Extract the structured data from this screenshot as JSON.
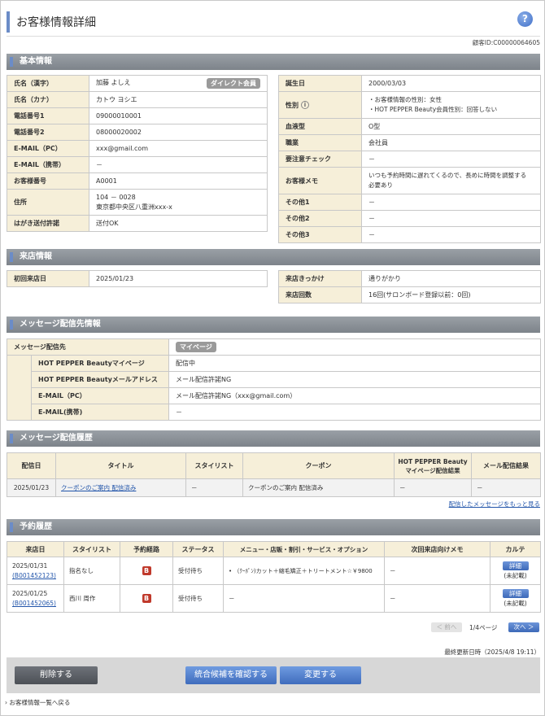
{
  "page": {
    "title": "お客様情報詳細",
    "help": "?",
    "customer_id": "顧客ID:C00000064605"
  },
  "sections": {
    "basic": "基本情報",
    "visit": "来店情報",
    "message_dest": "メッセージ配信先情報",
    "message_history": "メッセージ配信履歴",
    "reservation_history": "予約履歴"
  },
  "basic_left": {
    "rows": [
      {
        "label": "氏名（漢字）",
        "value": "加藤 よしえ",
        "badge": "ダイレクト会員"
      },
      {
        "label": "氏名（カナ）",
        "value": "カトウ ヨシエ"
      },
      {
        "label": "電話番号1",
        "value": "09000010001"
      },
      {
        "label": "電話番号2",
        "value": "08000020002"
      },
      {
        "label": "E-MAIL（PC）",
        "value": "xxx@gmail.com"
      },
      {
        "label": "E-MAIL（携帯）",
        "value": "－"
      },
      {
        "label": "お客様番号",
        "value": "A0001"
      },
      {
        "label": "住所",
        "value": "104 － 0028",
        "value2": "東京都中央区八重洲xxx-x"
      },
      {
        "label": "はがき送付許諾",
        "value": "送付OK"
      }
    ]
  },
  "basic_right": {
    "rows": [
      {
        "label": "誕生日",
        "value": "2000/03/03"
      },
      {
        "label": "性別",
        "value": "・お客様情報の性別：女性",
        "value2": "・HOT PEPPER Beauty会員性別：回答しない"
      },
      {
        "label": "血液型",
        "value": "O型"
      },
      {
        "label": "職業",
        "value": "会社員"
      },
      {
        "label": "要注意チェック",
        "value": "－"
      },
      {
        "label": "お客様メモ",
        "value": "いつも予約時間に遅れてくるので、長めに時間を調整する",
        "value2": "必要あり"
      },
      {
        "label": "その他1",
        "value": "－"
      },
      {
        "label": "その他2",
        "value": "－"
      },
      {
        "label": "その他3",
        "value": "－"
      }
    ]
  },
  "visit": {
    "first_visit_label": "初回来店日",
    "first_visit_value": "2025/01/23",
    "trigger_label": "来店きっかけ",
    "trigger_value": "通りがかり",
    "count_label": "来店回数",
    "count_value": "16回(サロンボード登録以前：0回)"
  },
  "message_dest": {
    "dest_label": "メッセージ配信先",
    "dest_badge": "マイページ",
    "rows": [
      {
        "label": "HOT PEPPER Beautyマイページ",
        "value": "配信中"
      },
      {
        "label": "HOT PEPPER Beautyメールアドレス",
        "value": "メール配信許諾NG"
      },
      {
        "label": "E-MAIL（PC）",
        "value": "メール配信許諾NG（xxx@gmail.com）"
      },
      {
        "label": "E-MAIL(携帯)",
        "value": "－"
      }
    ]
  },
  "message_history": {
    "headers": [
      "配信日",
      "タイトル",
      "スタイリスト",
      "クーポン",
      "HOT PEPPER Beauty",
      "マイページ配信結果",
      "メール配信結果"
    ],
    "rows": [
      {
        "date": "2025/01/23",
        "title": "クーポンのご案内 配信済み",
        "stylist": "－",
        "coupon": "クーポンのご案内 配信済み",
        "mypage": "－",
        "mail": "－"
      }
    ],
    "more_link": "配信したメッセージをもっと見る"
  },
  "reservation_history": {
    "headers": [
      "来店日",
      "スタイリスト",
      "予約経路",
      "ステータス",
      "メニュー・店販・割引・サービス・オプション",
      "次回来店向けメモ",
      "カルテ"
    ],
    "rows": [
      {
        "date": "2025/01/31",
        "id": "(B001452123)",
        "stylist": "指名なし",
        "route": "B",
        "status": "受付待ち",
        "menu": "（ｸｰﾎﾟﾝ)カット＋縮毛矯正＋トリートメント☆￥9800",
        "memo": "－",
        "detail": "詳細",
        "note": "(未記載)"
      },
      {
        "date": "2025/01/25",
        "id": "(B001452065)",
        "stylist": "西川 周作",
        "route": "B",
        "status": "受付待ち",
        "menu": "－",
        "memo": "－",
        "detail": "詳細",
        "note": "(未記載)"
      }
    ],
    "prev": "＜ 前へ",
    "page": "1/4ページ",
    "next": "次へ ＞"
  },
  "footer": {
    "updated": "最終更新日時（2025/4/8 19:11）",
    "delete": "削除する",
    "merge": "統合候補を確認する",
    "change": "変更する",
    "back_link": "お客様情報一覧へ戻る"
  },
  "colors": {
    "accent": "#6b8cc7",
    "label_bg": "#f6efd9",
    "button_blue": "#4a76c4",
    "button_dark": "#5b5f66"
  }
}
